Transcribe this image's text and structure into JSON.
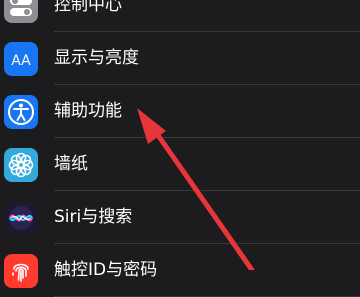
{
  "settings": {
    "items": [
      {
        "label": "控制中心",
        "icon": "control-center-icon",
        "color": "#8e8e93"
      },
      {
        "label": "显示与亮度",
        "icon": "display-brightness-icon",
        "color": "#1976f2",
        "glyph": "AA"
      },
      {
        "label": "辅助功能",
        "icon": "accessibility-icon",
        "color": "#1976f2"
      },
      {
        "label": "墙纸",
        "icon": "wallpaper-icon",
        "color": "#34aadc"
      },
      {
        "label": "Siri与搜索",
        "icon": "siri-icon",
        "color": "#1b1b2e"
      },
      {
        "label": "触控ID与密码",
        "icon": "fingerprint-icon",
        "color": "#ff3b30"
      }
    ]
  },
  "annotation": {
    "type": "arrow",
    "color": "#e8353a",
    "points_to": "辅助功能"
  }
}
